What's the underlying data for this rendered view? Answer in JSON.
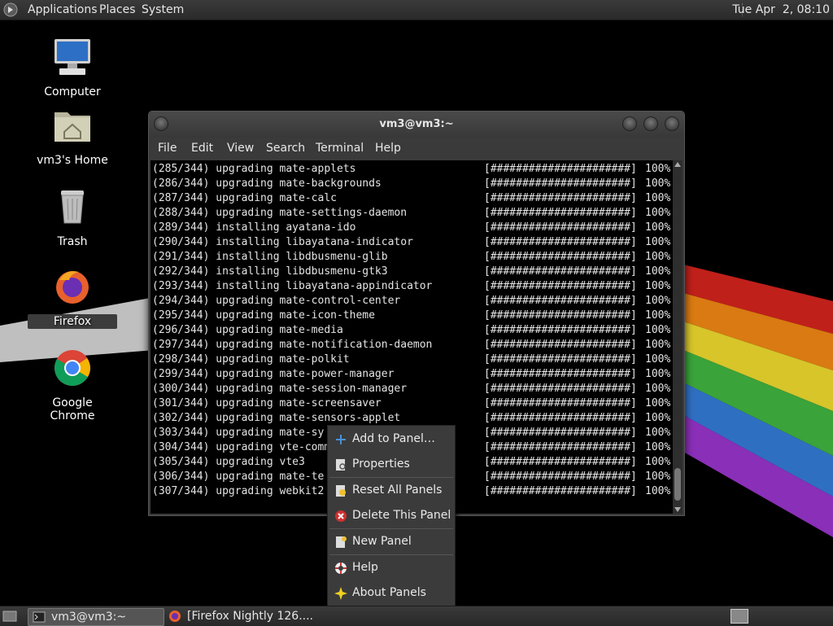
{
  "top_panel": {
    "menus": [
      "Applications",
      "Places",
      "System"
    ],
    "clock": "Tue Apr  2, 08:10"
  },
  "desktop_icons": [
    {
      "label": "Computer",
      "icon": "computer-icon"
    },
    {
      "label": "vm3's Home",
      "icon": "home-folder-icon"
    },
    {
      "label": "Trash",
      "icon": "trash-icon"
    },
    {
      "label": "Firefox",
      "icon": "firefox-icon"
    },
    {
      "label": "Google Chrome",
      "icon": "chrome-icon"
    }
  ],
  "terminal": {
    "title": "vm3@vm3:~",
    "menus": [
      "File",
      "Edit",
      "View",
      "Search",
      "Terminal",
      "Help"
    ],
    "lines": [
      {
        "text": "(285/344) upgrading mate-applets",
        "bar": "[######################]",
        "pct": "100%"
      },
      {
        "text": "(286/344) upgrading mate-backgrounds",
        "bar": "[######################]",
        "pct": "100%"
      },
      {
        "text": "(287/344) upgrading mate-calc",
        "bar": "[######################]",
        "pct": "100%"
      },
      {
        "text": "(288/344) upgrading mate-settings-daemon",
        "bar": "[######################]",
        "pct": "100%"
      },
      {
        "text": "(289/344) installing ayatana-ido",
        "bar": "[######################]",
        "pct": "100%"
      },
      {
        "text": "(290/344) installing libayatana-indicator",
        "bar": "[######################]",
        "pct": "100%"
      },
      {
        "text": "(291/344) installing libdbusmenu-glib",
        "bar": "[######################]",
        "pct": "100%"
      },
      {
        "text": "(292/344) installing libdbusmenu-gtk3",
        "bar": "[######################]",
        "pct": "100%"
      },
      {
        "text": "(293/344) installing libayatana-appindicator",
        "bar": "[######################]",
        "pct": "100%"
      },
      {
        "text": "(294/344) upgrading mate-control-center",
        "bar": "[######################]",
        "pct": "100%"
      },
      {
        "text": "(295/344) upgrading mate-icon-theme",
        "bar": "[######################]",
        "pct": "100%"
      },
      {
        "text": "(296/344) upgrading mate-media",
        "bar": "[######################]",
        "pct": "100%"
      },
      {
        "text": "(297/344) upgrading mate-notification-daemon",
        "bar": "[######################]",
        "pct": "100%"
      },
      {
        "text": "(298/344) upgrading mate-polkit",
        "bar": "[######################]",
        "pct": "100%"
      },
      {
        "text": "(299/344) upgrading mate-power-manager",
        "bar": "[######################]",
        "pct": "100%"
      },
      {
        "text": "(300/344) upgrading mate-session-manager",
        "bar": "[######################]",
        "pct": "100%"
      },
      {
        "text": "(301/344) upgrading mate-screensaver",
        "bar": "[######################]",
        "pct": "100%"
      },
      {
        "text": "(302/344) upgrading mate-sensors-applet",
        "bar": "[######################]",
        "pct": "100%"
      },
      {
        "text": "(303/344) upgrading mate-sy",
        "bar": "[######################]",
        "pct": "100%"
      },
      {
        "text": "(304/344) upgrading vte-comm",
        "bar": "[######################]",
        "pct": "100%"
      },
      {
        "text": "(305/344) upgrading vte3",
        "bar": "[######################]",
        "pct": "100%"
      },
      {
        "text": "(306/344) upgrading mate-te",
        "bar": "[######################]",
        "pct": "100%"
      },
      {
        "text": "(307/344) upgrading webkit2",
        "bar": "[######################]",
        "pct": "100%"
      }
    ]
  },
  "context_menu": {
    "items": [
      {
        "label": "Add to Panel…",
        "icon": "add-icon"
      },
      {
        "label": "Properties",
        "icon": "properties-icon"
      },
      {
        "label": "Reset All Panels",
        "icon": "reset-icon"
      },
      {
        "label": "Delete This Panel",
        "icon": "delete-icon"
      },
      {
        "label": "New Panel",
        "icon": "new-panel-icon"
      },
      {
        "label": "Help",
        "icon": "help-icon"
      },
      {
        "label": "About Panels",
        "icon": "about-icon"
      }
    ]
  },
  "taskbar": {
    "items": [
      {
        "label": "vm3@vm3:~",
        "icon": "terminal-icon"
      },
      {
        "label": "[Firefox Nightly 126....",
        "icon": "firefox-icon"
      }
    ]
  },
  "colors": {
    "panel": "#2e2e2e",
    "terminal_bg": "#000000",
    "menu_bg": "#3b3b3b"
  }
}
